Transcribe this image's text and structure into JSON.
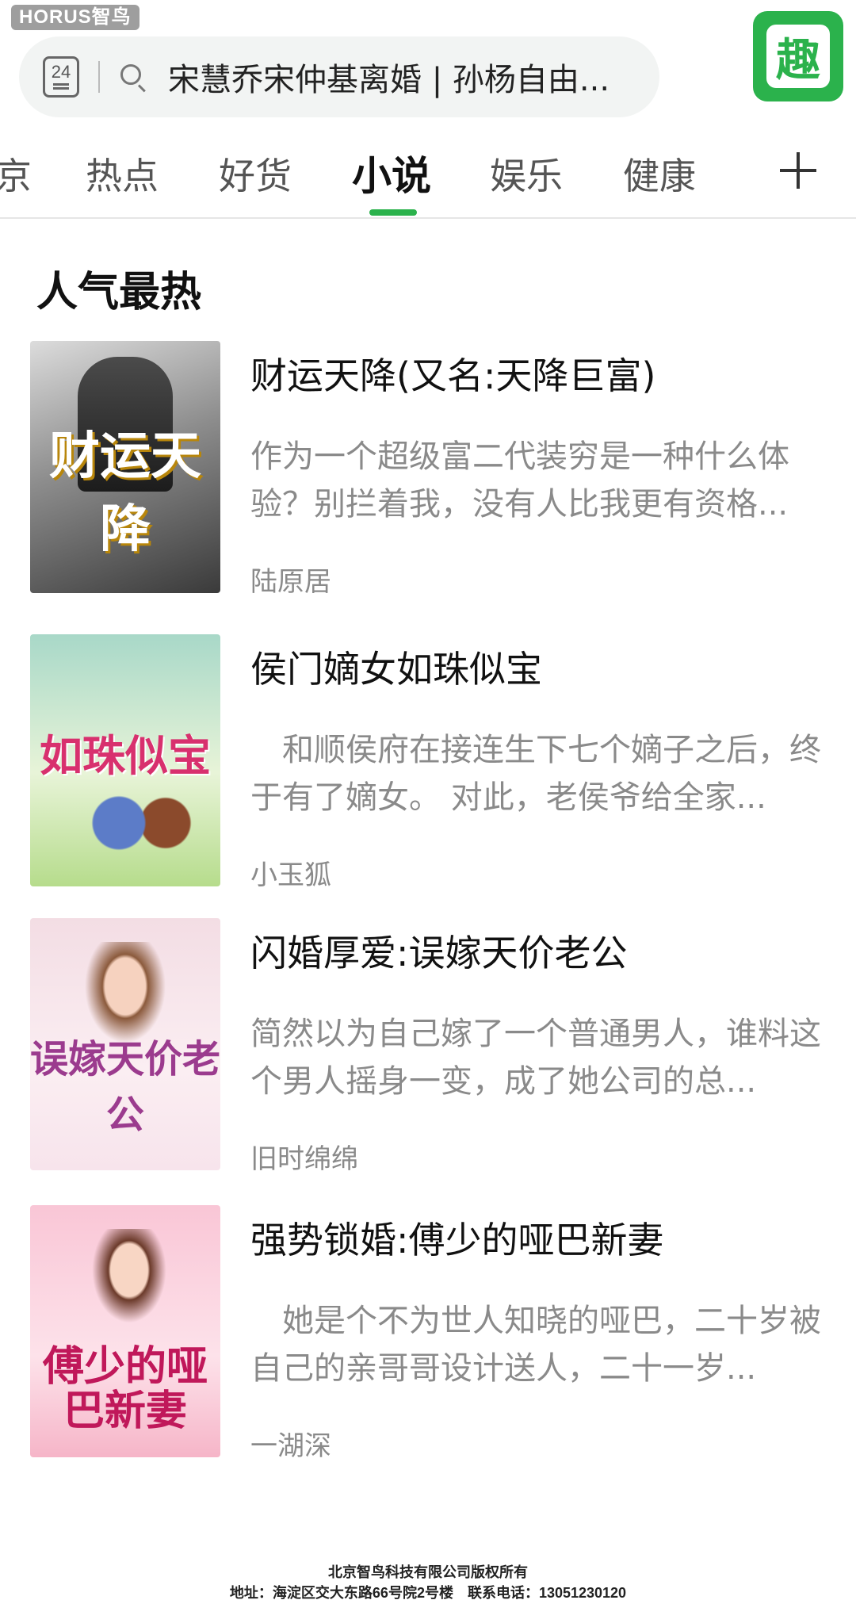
{
  "watermark": "HORUS智鸟",
  "search": {
    "calendar_day": "24",
    "query": "宋慧乔宋仲基离婚 | 孙杨自由..."
  },
  "app_logo_char": "趣",
  "tabs": [
    {
      "label": "京"
    },
    {
      "label": "热点"
    },
    {
      "label": "好货"
    },
    {
      "label": "小说"
    },
    {
      "label": "娱乐"
    },
    {
      "label": "健康"
    }
  ],
  "section": {
    "title": "人气最热"
  },
  "books": [
    {
      "cover_text": "财运天降",
      "title": "财运天降(又名:天降巨富)",
      "desc": "作为一个超级富二代装穷是一种什么体验？别拦着我，没有人比我更有资格...",
      "author": "陆原居"
    },
    {
      "cover_text": "如珠似宝",
      "title": "侯门嫡女如珠似宝",
      "desc": "　和顺侯府在接连生下七个嫡子之后，终于有了嫡女。 对此，老侯爷给全家...",
      "author": "小玉狐"
    },
    {
      "cover_text": "误嫁天价老公",
      "title": "闪婚厚爱:误嫁天价老公",
      "desc": "简然以为自己嫁了一个普通男人，谁料这个男人摇身一变，成了她公司的总...",
      "author": "旧时绵绵"
    },
    {
      "cover_text": "傅少的哑巴新妻",
      "title": "强势锁婚:傅少的哑巴新妻",
      "desc": "　她是个不为世人知晓的哑巴，二十岁被自己的亲哥哥设计送人，二十一岁...",
      "author": "一湖深"
    }
  ],
  "footer": {
    "line1": "北京智鸟科技有限公司版权所有",
    "line2": "地址：海淀区交大东路66号院2号楼　联系电话：13051230120"
  },
  "colors": {
    "accent": "#2bb24c"
  }
}
